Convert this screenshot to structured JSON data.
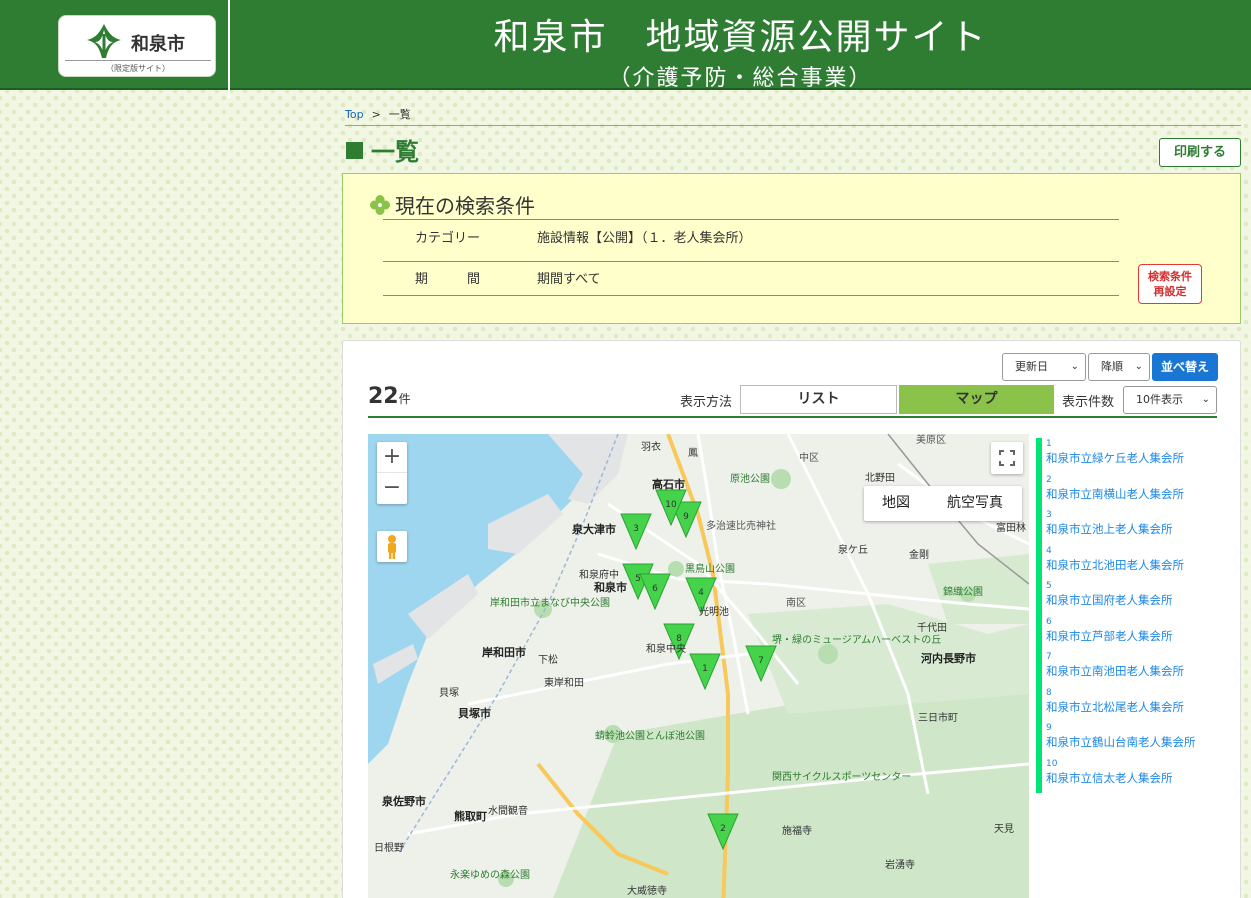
{
  "header": {
    "logo_name": "和泉市",
    "logo_sub": "（限定版サイト）",
    "title": "和泉市　地域資源公開サイト",
    "subtitle": "（介護予防・総合事業）",
    "brand_color": "#2e7d32"
  },
  "breadcrumb": {
    "home": "Top",
    "separator": ">",
    "current": "一覧"
  },
  "page": {
    "title": "一覧",
    "print_label": "印刷する"
  },
  "conditions": {
    "title": "現在の検索条件",
    "category_label": "カテゴリー",
    "category_value": "施設情報【公開】（１．老人集会所）",
    "period_label": "期　　　間",
    "period_value": "期間すべて",
    "reset_label_1": "検索条件",
    "reset_label_2": "再設定"
  },
  "results": {
    "sort_field": "更新日",
    "sort_order": "降順",
    "sort_button": "並べ替え",
    "count": "22",
    "count_unit": "件",
    "view_label": "表示方法",
    "view_list": "リスト",
    "view_map": "マップ",
    "perpage_label": "表示件数",
    "perpage_value": "10件表示"
  },
  "map": {
    "zoom_in": "+",
    "zoom_out": "−",
    "type_map": "地図",
    "type_satellite": "航空写真",
    "places": {
      "hagoromo": "羽衣",
      "otori": "鳳",
      "takaishi": "高石市",
      "haraike": "原池公園",
      "naka": "中区",
      "kitanoda": "北野田",
      "bishoen": "美原区",
      "izumiotsu": "泉大津市",
      "tajiri": "多治速比売神社",
      "izumigaoka": "泉ケ丘",
      "kanaoka": "金剛",
      "tondabayashi": "富田林",
      "kurotoriyama": "黒鳥山公園",
      "izumifuchu": "和泉府中",
      "izumi": "和泉市",
      "komyoike": "光明池",
      "minami": "南区",
      "nishikiori": "錦織公園",
      "kishiwadachuo": "岸和田市立まなび中央公園",
      "kishiwada": "岸和田市",
      "shimomatsu": "下松",
      "higashikishiwada": "東岸和田",
      "izumichuo": "和泉中央",
      "harvest": "堺・緑のミュージアムハーベストの丘",
      "kawachinagano": "河内長野市",
      "chiyoda": "千代田",
      "kaizuka": "貝塚",
      "kaizukashi": "貝塚市",
      "mikkaichi": "三日市町",
      "tonbo": "蜻蛉池公園とんぼ池公園",
      "kansai": "関西サイクルスポーツセンター",
      "izumisano": "泉佐野市",
      "kumatori": "熊取町",
      "mizuma": "水間観音",
      "shifukuji": "施福寺",
      "amami": "天見",
      "hineno": "日根野",
      "eirakuyume": "永楽ゆめの森公園",
      "iwawaki": "岩湧寺",
      "oinoseki": "大威徳寺"
    },
    "markers": [
      "1",
      "2",
      "3",
      "4",
      "5",
      "6",
      "7",
      "8",
      "9",
      "10"
    ]
  },
  "facilities": [
    {
      "num": "1",
      "name": "和泉市立緑ケ丘老人集会所"
    },
    {
      "num": "2",
      "name": "和泉市立南横山老人集会所"
    },
    {
      "num": "3",
      "name": "和泉市立池上老人集会所"
    },
    {
      "num": "4",
      "name": "和泉市立北池田老人集会所"
    },
    {
      "num": "5",
      "name": "和泉市立国府老人集会所"
    },
    {
      "num": "6",
      "name": "和泉市立芦部老人集会所"
    },
    {
      "num": "7",
      "name": "和泉市立南池田老人集会所"
    },
    {
      "num": "8",
      "name": "和泉市立北松尾老人集会所"
    },
    {
      "num": "9",
      "name": "和泉市立鶴山台南老人集会所"
    },
    {
      "num": "10",
      "name": "和泉市立信太老人集会所"
    }
  ]
}
